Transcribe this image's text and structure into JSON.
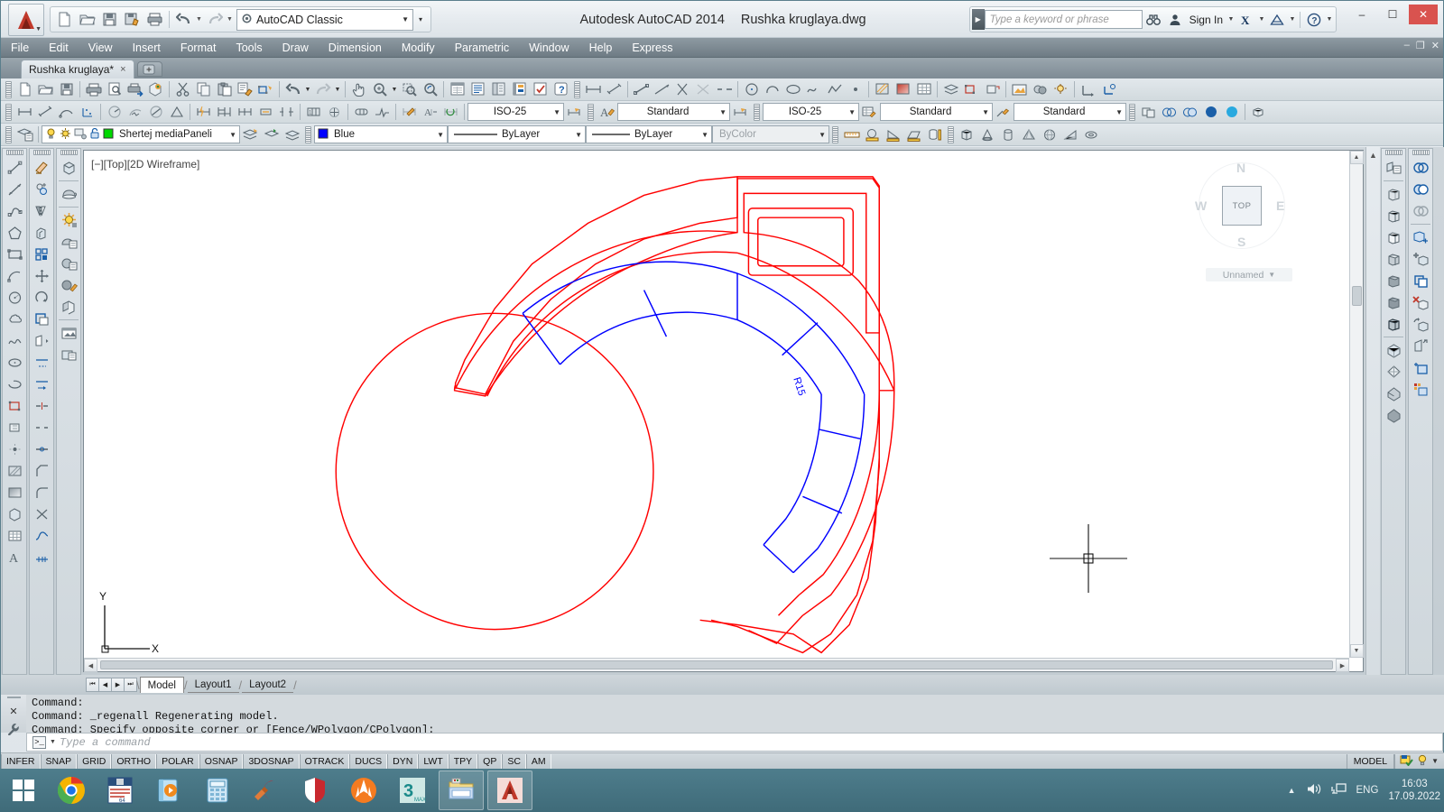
{
  "window": {
    "app_title": "Autodesk AutoCAD 2014",
    "file_title": "Rushka kruglaya.dwg",
    "minimize": "–",
    "maximize": "☐",
    "close": "✕",
    "doc_minimize": "–",
    "doc_restore": "❐",
    "doc_close": "✕"
  },
  "quick_access": {
    "workspace": "AutoCAD Classic",
    "items": [
      {
        "name": "qnew-icon",
        "label": "QNew"
      },
      {
        "name": "open-icon",
        "label": "Open"
      },
      {
        "name": "save-icon",
        "label": "Save"
      },
      {
        "name": "saveas-icon",
        "label": "Save As"
      },
      {
        "name": "plot-icon",
        "label": "Plot"
      },
      {
        "name": "undo-icon",
        "label": "Undo"
      },
      {
        "name": "redo-icon",
        "label": "Redo"
      }
    ]
  },
  "infocenter": {
    "placeholder": "Type a keyword or phrase",
    "sign_in": "Sign In",
    "search_icon": "binoculars-icon",
    "exchange_icon": "autodesk-exchange-icon",
    "cloud_icon": "autodesk-360-icon",
    "help_icon": "help-icon"
  },
  "menu": {
    "items": [
      "File",
      "Edit",
      "View",
      "Insert",
      "Format",
      "Tools",
      "Draw",
      "Dimension",
      "Modify",
      "Parametric",
      "Window",
      "Help",
      "Express"
    ]
  },
  "doc_tab": {
    "label": "Rushka kruglaya*",
    "close": "×",
    "new_tab_icon": "new-drawing-tab-icon"
  },
  "toolbars": {
    "row1_standard": [
      "new-icon",
      "open-icon",
      "save-icon",
      "plot-icon",
      "plot-preview-icon",
      "publish-icon",
      "3dprint-icon",
      "cut-icon",
      "copy-icon",
      "paste-icon",
      "matchprop-icon",
      "blockeditor-icon",
      "undo-icon",
      "redo-icon"
    ],
    "row1_pan": [
      "pan-icon",
      "zoom-realtime-icon",
      "zoom-window-icon",
      "zoom-previous-icon"
    ],
    "row1_props": [
      "properties-icon",
      "sheetset-icon",
      "designcenter-icon",
      "toolpalettes-icon",
      "markup-icon",
      "help-icon"
    ],
    "row2_dim": [
      "dimlinear-icon",
      "dimaligned-icon",
      "dimarc-icon",
      "dimordinate-icon",
      "dimradius-icon",
      "dimjogged-icon",
      "dimdiameter-icon",
      "dimangular-icon",
      "dimquick-icon",
      "dimbaseline-icon",
      "dimcontinue-icon",
      "dimspace-icon",
      "dimbreak-icon",
      "tolerance-icon",
      "centermark-icon",
      "inspect-icon",
      "jogline-icon",
      "dimedit-icon",
      "dimtextedit-icon",
      "dimupdate-icon"
    ],
    "dimstyle": "ISO-25",
    "textstyle": "Standard",
    "dimstyle2": "ISO-25",
    "tablestyle": "Standard",
    "mleaderstyle": "Standard",
    "layer_name": "Shertej mediaPaneli",
    "color": "Blue",
    "linetype": "ByLayer",
    "lineweight": "ByLayer",
    "plotstyle": "ByColor"
  },
  "viewport": {
    "label": "[−][Top][2D Wireframe]",
    "viewcube": {
      "top": "TOP",
      "n": "N",
      "s": "S",
      "w": "W",
      "e": "E",
      "ucs": "Unnamed"
    },
    "ucs_icon": {
      "x": "X",
      "y": "Y"
    }
  },
  "layout_tabs": {
    "nav": [
      "⏮",
      "◀",
      "▶",
      "⏭"
    ],
    "tabs": [
      "Model",
      "Layout1",
      "Layout2"
    ],
    "active": "Model"
  },
  "command_window": {
    "lines": [
      "Command:",
      "Command: _regenall Regenerating model.",
      "Command: Specify opposite corner or [Fence/WPolygon/CPolygon]:"
    ],
    "input_placeholder": "Type a command",
    "close_icon": "✕",
    "settings_icon": "wrench-icon"
  },
  "status_bar": {
    "toggles": [
      "INFER",
      "SNAP",
      "GRID",
      "ORTHO",
      "POLAR",
      "OSNAP",
      "3DOSNAP",
      "OTRACK",
      "DUCS",
      "DYN",
      "LWT",
      "TPY",
      "QP",
      "SC",
      "AM"
    ],
    "space": "MODEL",
    "right_icons": [
      "annotation-scale-icon",
      "lightbulb-icon",
      "expand-icon"
    ]
  },
  "taskbar": {
    "start_icon": "windows-start-icon",
    "items": [
      {
        "name": "chrome-icon",
        "label": "Google Chrome"
      },
      {
        "name": "floppy-64-icon",
        "label": "Save64"
      },
      {
        "name": "media-player-icon",
        "label": "Media Player"
      },
      {
        "name": "calculator-icon",
        "label": "Calculator"
      },
      {
        "name": "ccleaner-icon",
        "label": "CCleaner"
      },
      {
        "name": "shield-icon",
        "label": "Antivirus"
      },
      {
        "name": "avast-icon",
        "label": "Avast"
      },
      {
        "name": "3dsmax-icon",
        "label": "3ds Max"
      },
      {
        "name": "explorer-icon",
        "label": "File Explorer"
      },
      {
        "name": "autocad-icon",
        "label": "AutoCAD"
      }
    ],
    "tray": {
      "show_hidden": "▲",
      "volume_icon": "volume-icon",
      "network_icon": "network-icon",
      "language": "ENG",
      "time": "16:03",
      "date": "17.09.2022"
    }
  },
  "colors": {
    "drawing_red": "#ff0000",
    "drawing_blue": "#0000ff",
    "taskbar": "#43707f",
    "accent": "#c0392b"
  }
}
